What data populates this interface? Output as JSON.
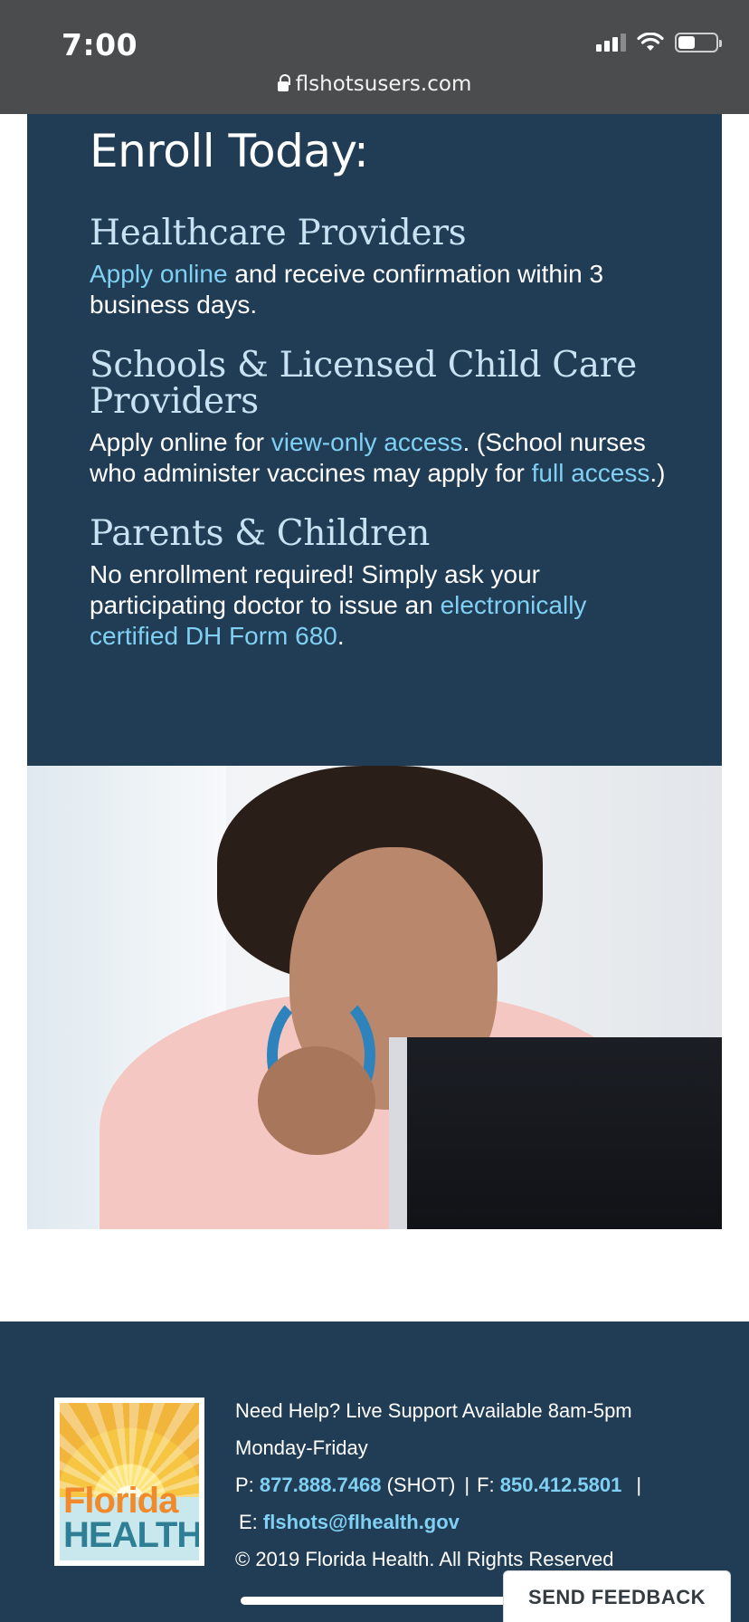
{
  "status_bar": {
    "time": "7:00",
    "url": "flshotsusers.com"
  },
  "enroll": {
    "title": "Enroll Today:",
    "providers": {
      "heading": "Healthcare Providers",
      "link": "Apply online",
      "text": " and receive confirmation within 3 business days."
    },
    "schools": {
      "heading": "Schools & Licensed Child Care Providers",
      "text_before": "Apply online for ",
      "link_view": "view-only access",
      "text_middle": ". (School nurses who administer vaccines may apply for ",
      "link_full": "full access",
      "text_after": ".)"
    },
    "parents": {
      "heading": "Parents & Children",
      "text_before": "No enrollment required! Simply ask your participating doctor to issue an ",
      "link": "electronically certified DH Form 680",
      "text_after": "."
    }
  },
  "photo": {
    "description_icon": "photo-nurse-at-computer"
  },
  "footer": {
    "logo_line1": "Florida",
    "logo_line2": "HEALTH",
    "help_line1": "Need Help? Live Support Available 8am-5pm",
    "help_line2": "Monday-Friday",
    "phone_label": "P: ",
    "phone": "877.888.7468",
    "phone_suffix": " (SHOT)",
    "sep": "|",
    "fax_label": "F: ",
    "fax": "850.412.5801",
    "email_label": "E: ",
    "email": "flshots@flhealth.gov",
    "copyright": "© 2019 Florida Health. All Rights Reserved"
  },
  "feedback_button": "SEND FEEDBACK",
  "colors": {
    "panel": "#213d55",
    "link": "#7fd0f2",
    "heading": "#c9e2f3"
  }
}
